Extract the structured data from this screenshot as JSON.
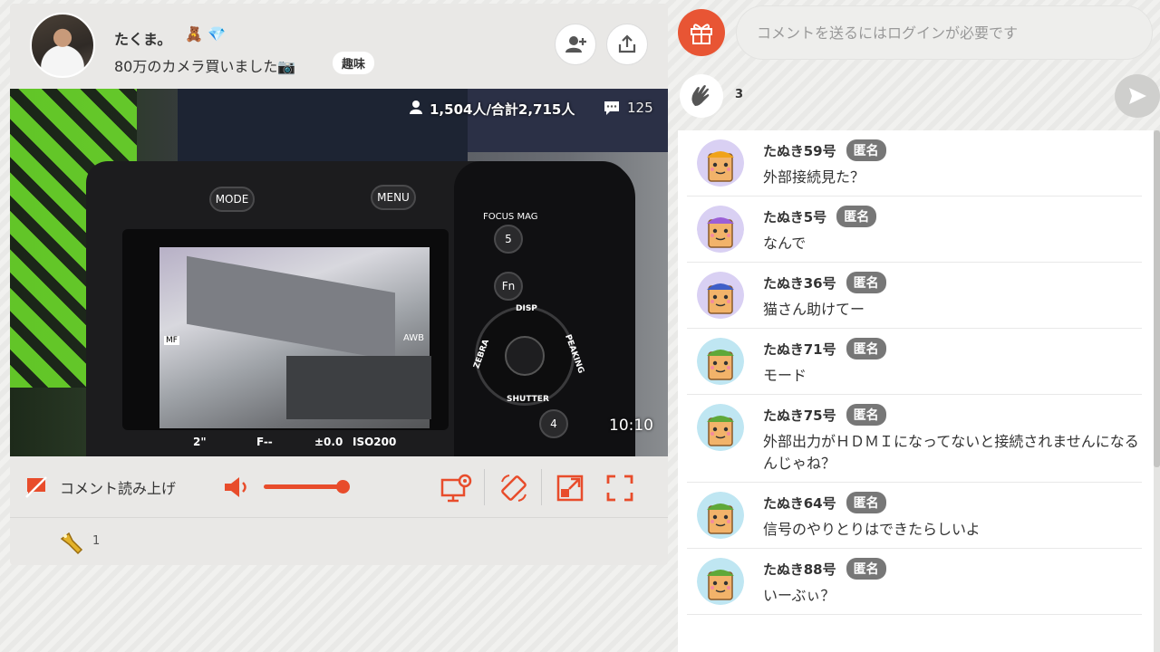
{
  "streamer": {
    "name": "たくま。",
    "badge1_icon": "🧸",
    "badge2_icon": "💎",
    "title": "80万のカメラ買いました📷",
    "category": "趣味"
  },
  "video": {
    "viewers": "1,504人/合計2,715人",
    "comments_count": "125",
    "clock": "10:10",
    "camera_labels": {
      "mode": "MODE",
      "menu": "MENU",
      "focus_mag": "FOCUS MAG",
      "btn5": "5",
      "fn": "Fn",
      "btn4": "4",
      "disp": "DISP",
      "zebra": "ZEBRA",
      "peaking": "PEAKING",
      "shutter": "SHUTTER",
      "osd_shutter": "2\"",
      "osd_fnum": "F--",
      "osd_ev": "±0.0",
      "osd_iso": "ISO200",
      "osd_awb": "AWB",
      "osd_mf": "MF"
    }
  },
  "controls": {
    "read_aloud_label": "コメント読み上げ",
    "volume_level": 1.0
  },
  "footer": {
    "flashlight_count": "1"
  },
  "comment_box": {
    "placeholder": "コメントを送るにはログインが必要です",
    "clap_count": "3"
  },
  "comments": [
    {
      "name": "たぬき59号",
      "tag": "匿名",
      "text": "外部接続見た？",
      "hat_color": "#f0a31a",
      "ring": "#d9d0f3"
    },
    {
      "name": "たぬき5号",
      "tag": "匿名",
      "text": "なんで",
      "hat_color": "#9b5fd6",
      "ring": "#d9d0f3"
    },
    {
      "name": "たぬき36号",
      "tag": "匿名",
      "text": "猫さん助けてー",
      "hat_color": "#3f5fc8",
      "ring": "#d9d0f3"
    },
    {
      "name": "たぬき71号",
      "tag": "匿名",
      "text": "モード",
      "hat_color": "#5fa839",
      "ring": "#bfe6f2"
    },
    {
      "name": "たぬき75号",
      "tag": "匿名",
      "text": "外部出力がＨＤＭＩになってないと接続されませんになるんじゃね？",
      "hat_color": "#5fa839",
      "ring": "#bfe6f2"
    },
    {
      "name": "たぬき64号",
      "tag": "匿名",
      "text": "信号のやりとりはできたらしいよ",
      "hat_color": "#5fa839",
      "ring": "#bfe6f2"
    },
    {
      "name": "たぬき88号",
      "tag": "匿名",
      "text": "いーぶぃ？",
      "hat_color": "#5fa839",
      "ring": "#bfe6f2"
    }
  ],
  "colors": {
    "accent": "#e84c2b",
    "panel": "#e9e8e6"
  }
}
